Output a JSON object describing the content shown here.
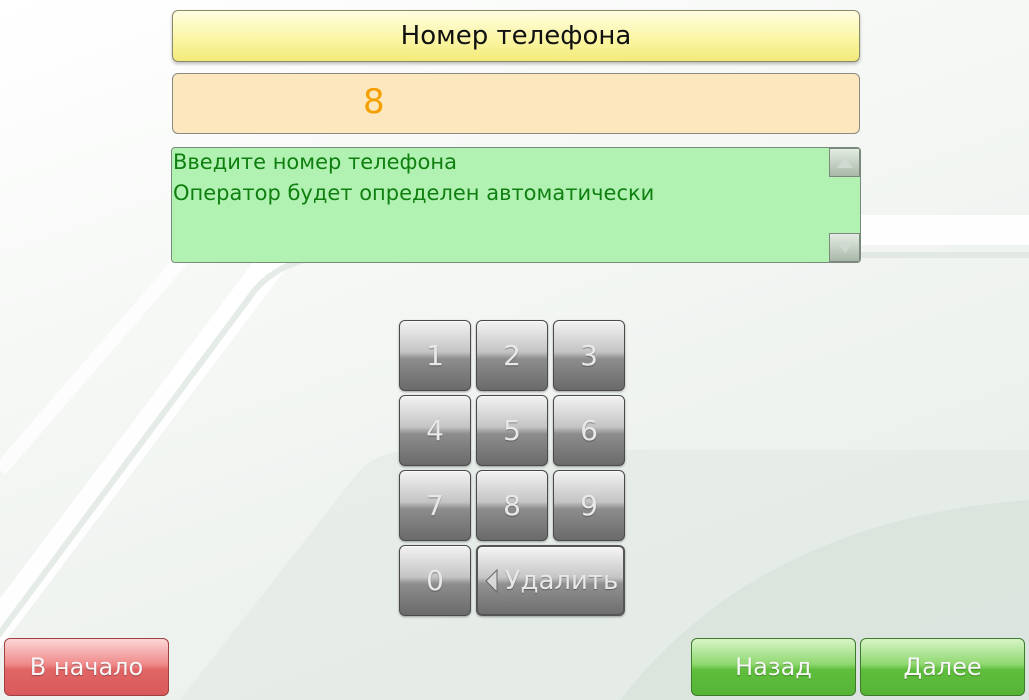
{
  "title": "Номер телефона",
  "value": "8",
  "info": {
    "lines": [
      "Введите номер телефона",
      "Оператор будет определен автоматически"
    ]
  },
  "keypad": {
    "keys": [
      "1",
      "2",
      "3",
      "4",
      "5",
      "6",
      "7",
      "8",
      "9",
      "0"
    ],
    "delete_label": "Удалить"
  },
  "nav": {
    "home_label": "В начало",
    "back_label": "Назад",
    "next_label": "Далее"
  },
  "colors": {
    "title_bg": "#fbf6a6",
    "value_bg": "#fce7bf",
    "value_text": "#f5a000",
    "info_bg": "#b1f2b3",
    "info_text": "#0f7f10",
    "home_button": "#e06565",
    "nav_button": "#5fbe3c"
  }
}
